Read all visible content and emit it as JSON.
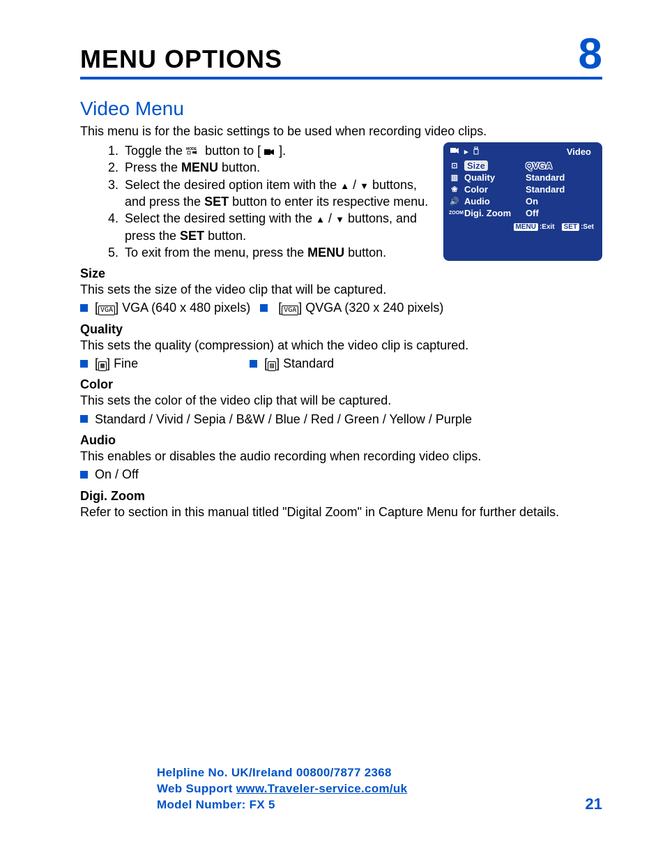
{
  "chapter": {
    "title": "MENU OPTIONS",
    "number": "8"
  },
  "section": {
    "title": "Video Menu",
    "intro": "This menu is for the basic settings to be used when recording video clips."
  },
  "steps": {
    "s1a": "Toggle the ",
    "s1b": " button to [ ",
    "s1c": " ].",
    "s2a": "Press the ",
    "s2b": "MENU",
    "s2c": " button.",
    "s3a": "Select the desired option item with the ",
    "s3b": " / ",
    "s3c": " buttons, and press the ",
    "s3d": "SET",
    "s3e": " button to enter its respective menu.",
    "s4a": "Select the desired setting with the ",
    "s4b": " / ",
    "s4c": " buttons, and press the ",
    "s4d": "SET",
    "s4e": " button.",
    "s5a": "To exit from the menu, press the ",
    "s5b": "MENU",
    "s5c": " button."
  },
  "size": {
    "head": "Size",
    "desc": "This sets the size of the video clip that will be captured.",
    "opt1_icon": "VGA",
    "opt1_text": "VGA (640 x 480 pixels)",
    "opt2_icon": "VGA",
    "opt2_text": "QVGA (320 x 240 pixels)"
  },
  "quality": {
    "head": "Quality",
    "desc": "This sets the quality (compression) at which the video clip is captured.",
    "opt1_text": "Fine",
    "opt2_text": "Standard"
  },
  "color": {
    "head": "Color",
    "desc": "This sets the color of the video clip that will be captured.",
    "opts": "Standard / Vivid / Sepia / B&W / Blue / Red / Green / Yellow / Purple"
  },
  "audio": {
    "head": "Audio",
    "desc": "This enables or disables the audio recording when recording video clips.",
    "opts": "On / Off"
  },
  "digizoom": {
    "head": "Digi. Zoom",
    "desc": "Refer to section in this manual titled \"Digital Zoom\" in Capture Menu for further details."
  },
  "lcd": {
    "title": "Video",
    "rows": [
      {
        "label": "Size",
        "value": "QVGA"
      },
      {
        "label": "Quality",
        "value": "Standard"
      },
      {
        "label": "Color",
        "value": "Standard"
      },
      {
        "label": "Audio",
        "value": "On"
      },
      {
        "label": "Digi. Zoom",
        "value": "Off"
      }
    ],
    "foot_menu": "MENU",
    "foot_menu_t": ":Exit",
    "foot_set": "SET",
    "foot_set_t": ":Set"
  },
  "footer": {
    "helpline": "Helpline No. UK/Ireland 00800/7877 2368",
    "web_label": "Web Support ",
    "web_url": "www.Traveler-service.com/uk",
    "model": "Model Number: FX 5",
    "pagenum": "21"
  }
}
